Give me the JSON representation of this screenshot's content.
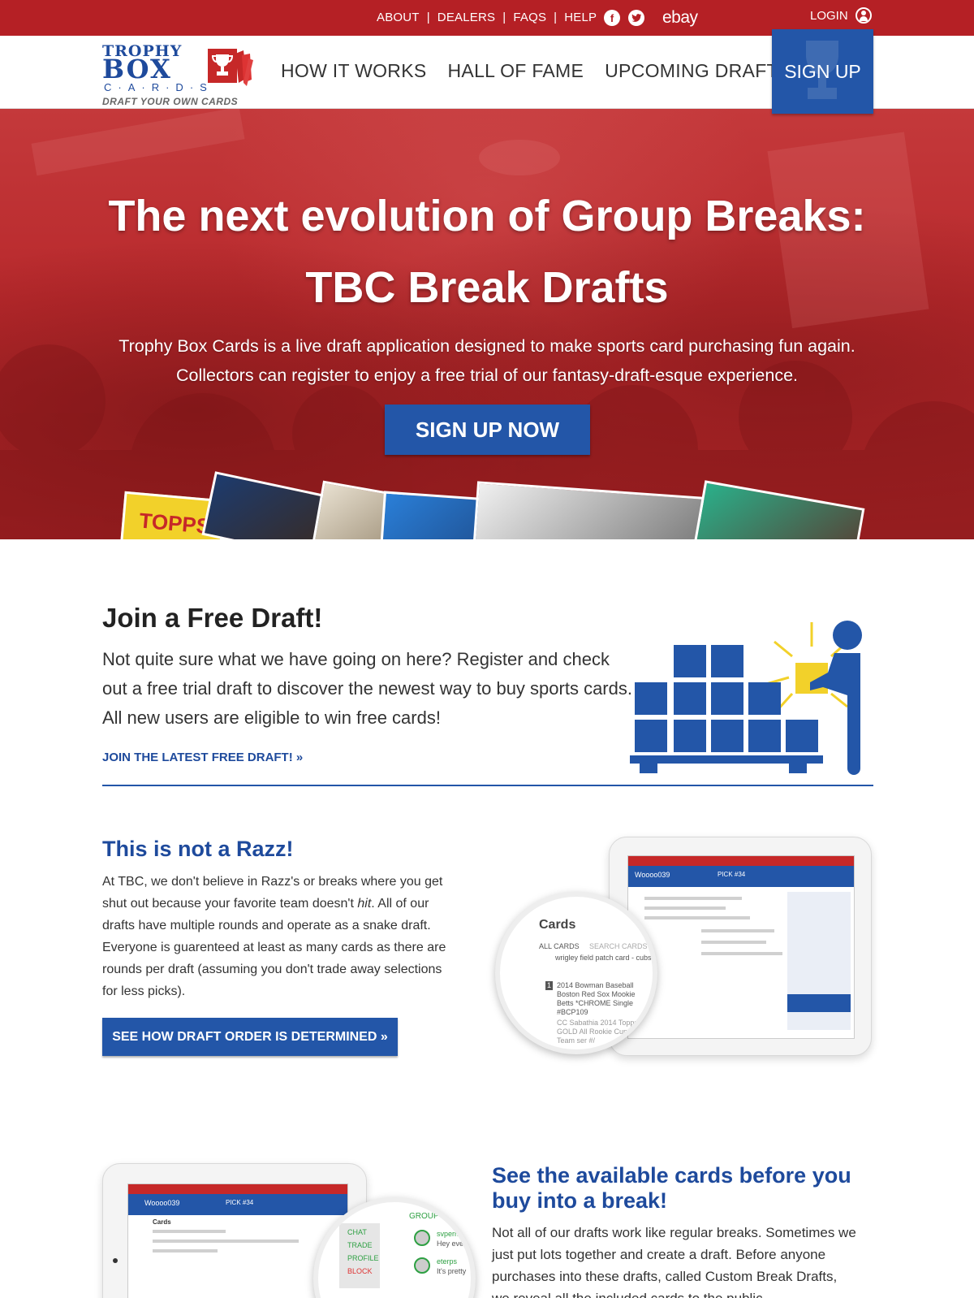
{
  "topbar": {
    "links": [
      "ABOUT",
      "DEALERS",
      "FAQS",
      "HELP"
    ],
    "separator": "|",
    "social": {
      "facebook_icon": "f",
      "twitter_icon": "t",
      "ebay": "ebay"
    },
    "login": "LOGIN"
  },
  "header": {
    "logo": {
      "line1": "TROPHY",
      "line2": "BOX",
      "line3": "C·A·R·D·S",
      "tagline": "DRAFT YOUR OWN CARDS"
    },
    "nav": [
      "HOW IT WORKS",
      "HALL OF FAME",
      "UPCOMING DRAFTS"
    ],
    "signup": "SIGN UP"
  },
  "hero": {
    "title_line1": "The next evolution of Group Breaks:",
    "title_line2": "TBC Break Drafts",
    "subtitle_line1": "Trophy Box Cards is a live draft application designed to make sports card purchasing fun again.",
    "subtitle_line2": "Collectors can register to enjoy a free trial of our fantasy-draft-esque experience.",
    "cta": "SIGN UP NOW",
    "card_text": "TOPPS"
  },
  "section_free_draft": {
    "title": "Join a Free Draft!",
    "text": "Not quite sure what we have going on here? Register and check out a free trial draft to discover the newest way to buy sports cards. All new users are eligible to win free cards!",
    "link": "JOIN THE LATEST FREE DRAFT! »"
  },
  "section_razz": {
    "title": "This is not a Razz!",
    "text_before_italic": "At TBC, we don't believe in Razz's or breaks where you get shut out because your favorite team doesn't ",
    "text_italic": "hit",
    "text_after_italic": ". All of our drafts have multiple rounds and operate as a snake draft. Everyone is guarenteed at least as many cards as there are rounds per draft (assuming you don't trade away selections for less picks).",
    "button": "SEE HOW DRAFT ORDER IS DETERMINED »",
    "zoom": {
      "title": "Cards",
      "tab": "ALL CARDS",
      "search": "SEARCH CARDS",
      "item1": "2014 Bowman Baseball Boston Red Sox Mookie Betts *CHROME Single #BCP109",
      "item2": "wrigley field patch card - cubs",
      "item3": "CC Sabathia 2014 Topps GOLD All Rookie Cup Team ser #/",
      "item_number": "1"
    },
    "screen_user": "Woooo039",
    "screen_pick": "PICK #34"
  },
  "section_cards": {
    "title": "See the available cards before you buy into a break!",
    "text": "Not all of our drafts work like regular breaks. Sometimes we just put lots together and create a draft. Before anyone purchases into these drafts, called Custom Break Drafts, we reveal all the included cards to the public.",
    "zoom": {
      "menu": [
        "CHAT",
        "TRADE",
        "PROFILE",
        "BLOCK"
      ],
      "heading": "GROUP CHA",
      "user1": "svperna",
      "msg1": "Hey every",
      "user2": "eterps",
      "msg2": "It's pretty"
    },
    "screen_user": "Woooo039",
    "screen_pick": "PICK #34",
    "screen_heading": "Cards"
  },
  "colors": {
    "brand_red": "#b52025",
    "brand_blue": "#2356a8",
    "accent_yellow": "#f2d12a"
  }
}
